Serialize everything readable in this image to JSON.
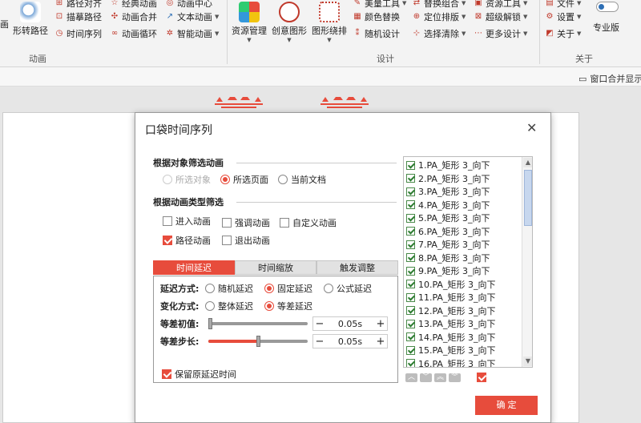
{
  "ribbon": {
    "left_stub": "画",
    "shape_path": "形转路径",
    "col_anim1": [
      "路径对齐",
      "描摹路径",
      "时间序列"
    ],
    "col_anim2": [
      "经典动画",
      "动画合并",
      "动画循环"
    ],
    "col_anim3": [
      "动画中心",
      "文本动画",
      "智能动画"
    ],
    "group_anim": "动画",
    "resource_mgmt": "资源管理",
    "creative_shape": "创意图形",
    "shape_arrange": "图形绕排",
    "col_design1": [
      "美量工具",
      "颜色替换",
      "随机设计"
    ],
    "col_design2": [
      "替换组合",
      "定位排版",
      "选择清除"
    ],
    "col_design3": [
      "资源工具",
      "超级解锁",
      "更多设计"
    ],
    "group_design": "设计",
    "file": "文件",
    "settings": "设置",
    "about": "关于",
    "pro": "专业版",
    "group_about": "关于"
  },
  "subbar": {
    "window_merge": "窗口合并显示"
  },
  "dialog": {
    "title": "口袋时间序列",
    "section_filter_object": "根据对象筛选动画",
    "radio_selected_object": "所选对象",
    "radio_selected_page": "所选页面",
    "radio_current_doc": "当前文档",
    "section_filter_type": "根据动画类型筛选",
    "cb_enter": "进入动画",
    "cb_emphasis": "强调动画",
    "cb_custom": "自定义动画",
    "cb_path": "路径动画",
    "cb_exit": "退出动画",
    "tabs": [
      "时间延迟",
      "时间缩放",
      "触发调整"
    ],
    "delay_mode_label": "延迟方式:",
    "delay_random": "随机延迟",
    "delay_fixed": "固定延迟",
    "delay_formula": "公式延迟",
    "change_mode_label": "变化方式:",
    "change_whole": "整体延迟",
    "change_equal": "等差延迟",
    "initial_label": "等差初值:",
    "initial_value": "0.05s",
    "initial_level": 0.0,
    "step_label": "等差步长:",
    "step_value": "0.05s",
    "step_level": 0.5,
    "keep_delay": "保留原延迟时间",
    "list_items": [
      "1.PA_矩形 3_向下",
      "2.PA_矩形 3_向下",
      "3.PA_矩形 3_向下",
      "4.PA_矩形 3_向下",
      "5.PA_矩形 3_向下",
      "6.PA_矩形 3_向下",
      "7.PA_矩形 3_向下",
      "8.PA_矩形 3_向下",
      "9.PA_矩形 3_向下",
      "10.PA_矩形 3_向下",
      "11.PA_矩形 3_向下",
      "12.PA_矩形 3_向下",
      "13.PA_矩形 3_向下",
      "14.PA_矩形 3_向下",
      "15.PA_矩形 3_向下",
      "16.PA_矩形 3_向下"
    ],
    "ok": "确 定",
    "minus": "−",
    "plus": "+"
  },
  "colors": {
    "accent": "#e74c3c",
    "list_check": "#2e7d32"
  }
}
